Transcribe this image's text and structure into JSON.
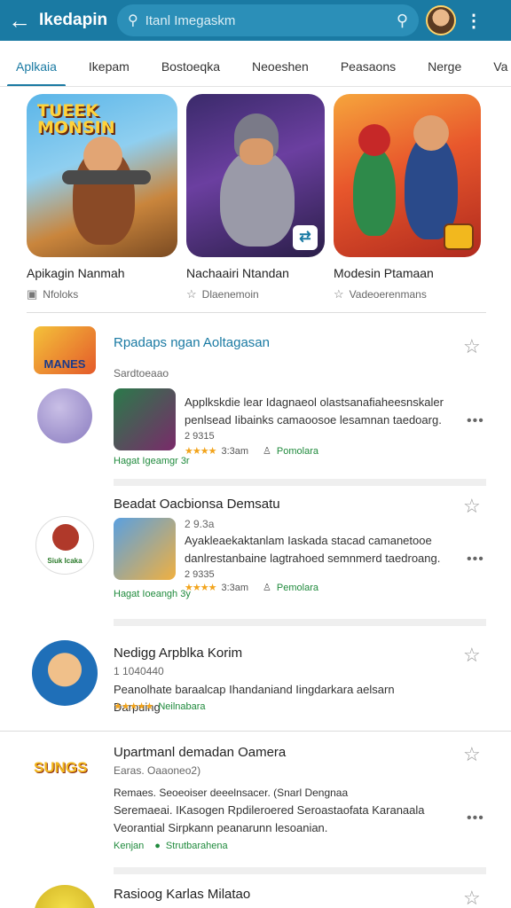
{
  "header": {
    "back_icon": "arrow-left-icon",
    "title": "Ikedapin",
    "search_placeholder": "Itanl Imegaskm"
  },
  "tabs": [
    {
      "label": "Aplkaia",
      "active": true
    },
    {
      "label": "Ikepam",
      "active": false
    },
    {
      "label": "Bostoeqka",
      "active": false
    },
    {
      "label": "Neoeshen",
      "active": false
    },
    {
      "label": "Peasaons",
      "active": false
    },
    {
      "label": "Nerge",
      "active": false
    },
    {
      "label": "Va",
      "active": false
    }
  ],
  "featured": [
    {
      "art_text": "TUEEK MONSIN",
      "caption": "Apikagin Nanmah",
      "sub": "Nfoloks"
    },
    {
      "art_text": "",
      "caption": "Nachaairi Ntandan",
      "sub": "Dlaenemoin"
    },
    {
      "art_text": "",
      "caption": "Modesin Ptamaan",
      "sub": "Vadeoerenmans"
    }
  ],
  "list": [
    {
      "title": "Rpadaps ngan Aoltagasan",
      "section_label": "Sardtoeaao",
      "logo_text": "MANES",
      "description": "Applkskdie lear Idagnaeol olastsanafiaheesnskaler penlsead Iibainks camaoosoe lesamnan taedoarg.",
      "rating_code": "2 9315",
      "rating_time": "3:3am",
      "publisher": "Pomolara",
      "category": "Hagat Igeamgr 3r"
    },
    {
      "title": "Beadat Oacbionsa Demsatu",
      "sub": "2 9.3a",
      "logo_text": "Siuk Icaka",
      "description": "Ayakleaekaktanlam Iaskada stacad camanetooe danlrestanbaine lagtrahoed semnmerd taedroang.",
      "rating_code": "2 9335",
      "rating_time": "3:3am",
      "publisher": "Pemolara",
      "category": "Hagat Ioeangh 3y"
    },
    {
      "title": "Nedigg Arpblka Korim",
      "sub": "1 1040440",
      "description": "Peanolhate baraalcap Ihandaniand Iingdarkara aelsarn Darpuing",
      "rating_tag": "Neilnabara"
    },
    {
      "title": "Upartmanl demadan Oamera",
      "sub": "Earas. Oaaoneo2)",
      "logo_text": "SUNGS",
      "line1": "Remaes. Seoeoiser deeelnsacer. (Snarl Dengnaa",
      "description": "Seremaeai. IKasogen Rpdileroered Seroastaofata Karanaala Veorantial Sirpkann peanarunn lesoanian.",
      "publisher_tag": "Kenjan",
      "category": "Strutbarahena"
    },
    {
      "title": "Rasioog Karlas Milatao"
    }
  ]
}
